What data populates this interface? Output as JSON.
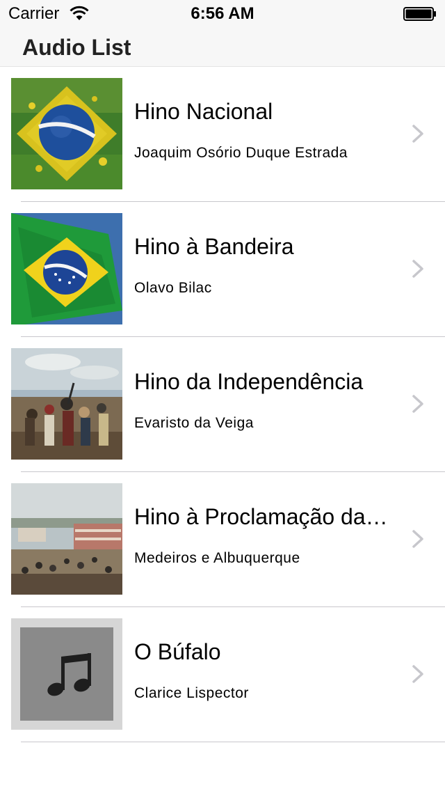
{
  "status_bar": {
    "carrier": "Carrier",
    "time": "6:56 AM",
    "wifi_icon": "wifi-icon",
    "battery_icon": "battery-full-icon"
  },
  "nav_bar": {
    "title": "Audio List"
  },
  "items": [
    {
      "title": "Hino Nacional",
      "subtitle": "Joaquim Osório Duque Estrada",
      "image": "brazil-flag-paint-image"
    },
    {
      "title": "Hino à Bandeira",
      "subtitle": "Olavo Bilac",
      "image": "brazil-flag-waving-image"
    },
    {
      "title": "Hino da Independência",
      "subtitle": "Evaristo da Veiga",
      "image": "independence-painting-image"
    },
    {
      "title": "Hino à Proclamação da República",
      "subtitle": "Medeiros e Albuquerque",
      "image": "proclamation-painting-image"
    },
    {
      "title": "O Búfalo",
      "subtitle": "Clarice Lispector",
      "image": "music-note-placeholder-icon"
    }
  ],
  "colors": {
    "bar_background": "#f7f7f7",
    "separator": "#c8c7cc",
    "chevron": "#c7c7cc"
  }
}
